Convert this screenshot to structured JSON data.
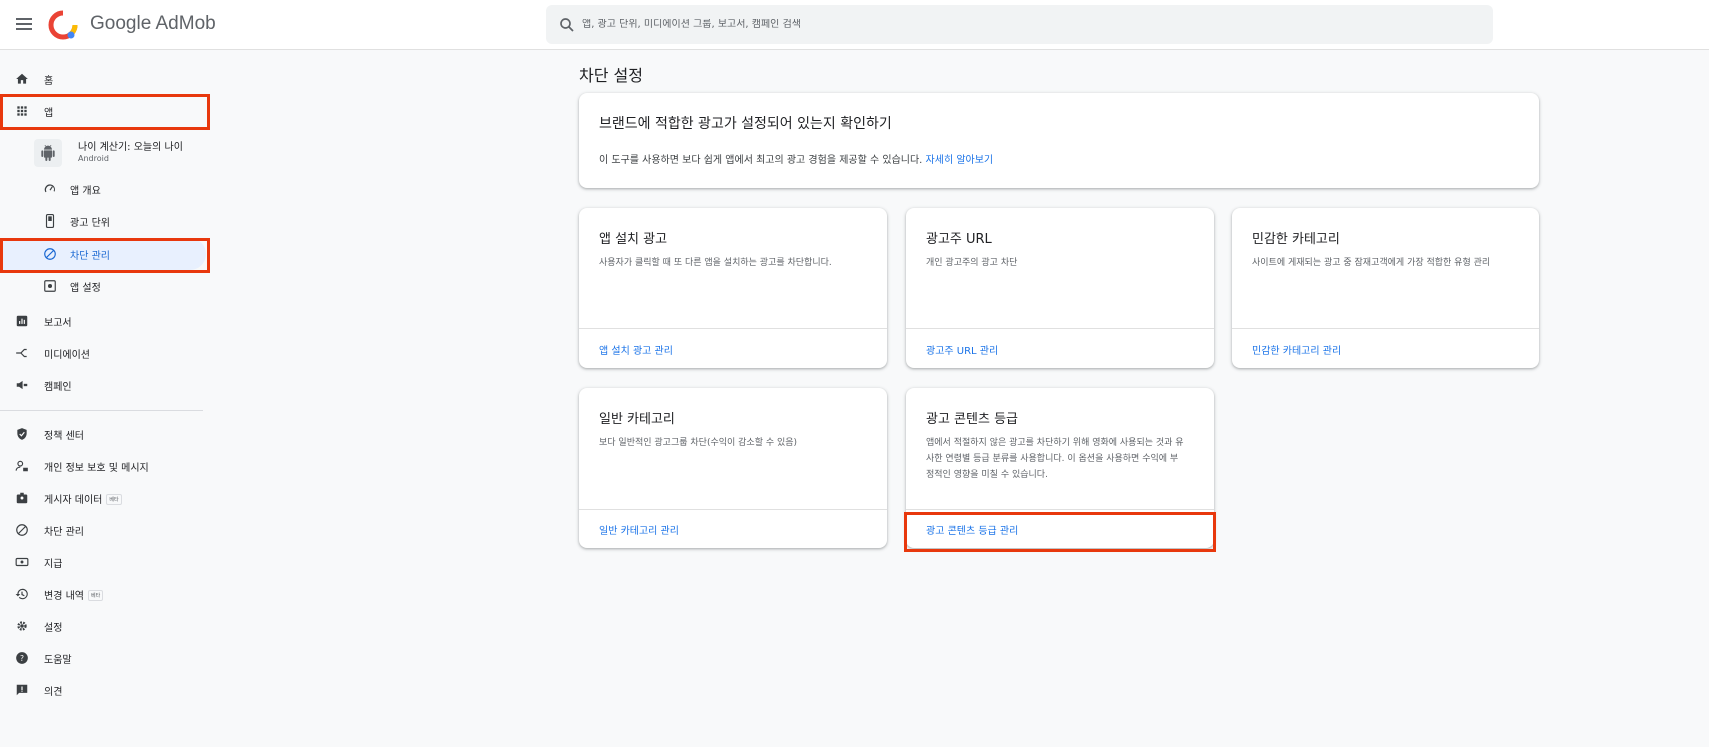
{
  "header": {
    "brand": "Google AdMob",
    "search_placeholder": "앱, 광고 단위, 미디에이션 그룹, 보고서, 캠페인 검색"
  },
  "sidebar": {
    "home": "홈",
    "apps": "앱",
    "app": {
      "name": "나이 계산기: 오늘의 나이",
      "platform": "Android"
    },
    "app_overview": "앱 개요",
    "ad_units": "광고 단위",
    "blocking": "차단 관리",
    "app_settings": "앱 설정",
    "reports": "보고서",
    "mediation": "미디에이션",
    "campaigns": "캠페인",
    "policy_center": "정책 센터",
    "privacy": "개인 정보 보호 및 메시지",
    "publisher_data": "게시자 데이터",
    "publisher_data_badge": "베타",
    "blocking_global": "차단 관리",
    "payments": "지급",
    "change_history": "변경 내역",
    "change_history_badge": "베타",
    "settings": "설정",
    "help": "도움말",
    "feedback": "의견"
  },
  "main": {
    "title": "차단 설정",
    "intro": {
      "title": "브랜드에 적합한 광고가 설정되어 있는지 확인하기",
      "text": "이 도구를 사용하면 보다 쉽게 앱에서 최고의 광고 경험을 제공할 수 있습니다.",
      "link": "자세히 알아보기"
    },
    "cards": [
      {
        "title": "앱 설치 광고",
        "desc": "사용자가 클릭할 때 또 다른 앱을 설치하는 광고를 차단합니다.",
        "link": "앱 설치 광고 관리"
      },
      {
        "title": "광고주 URL",
        "desc": "개인 광고주의 광고 차단",
        "link": "광고주 URL 관리"
      },
      {
        "title": "민감한 카테고리",
        "desc": "사이트에 게재되는 광고 중 잠재고객에게 가장 적합한 유형 관리",
        "link": "민감한 카테고리 관리"
      },
      {
        "title": "일반 카테고리",
        "desc": "보다 일반적인 광고그룹 차단(수익이 감소할 수 있음)",
        "link": "일반 카테고리 관리"
      },
      {
        "title": "광고 콘텐츠 등급",
        "desc": "앱에서 적절하지 않은 광고를 차단하기 위해 영화에 사용되는 것과 유사한 연령별 등급 분류를 사용합니다. 이 옵션을 사용하면 수익에 부정적인 영향을 미칠 수 있습니다.",
        "link": "광고 콘텐츠 등급 관리"
      }
    ]
  },
  "colors": {
    "accent": "#1a73e8",
    "highlight": "#e8380d",
    "active_bg": "#e8f0fe"
  }
}
